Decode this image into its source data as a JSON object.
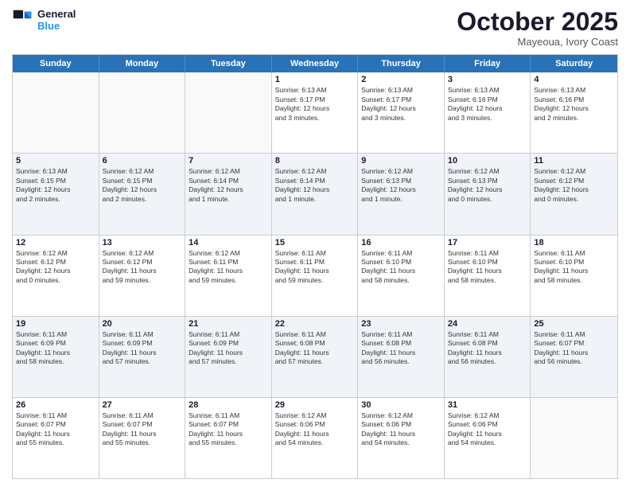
{
  "logo": {
    "line1": "General",
    "line2": "Blue"
  },
  "header": {
    "month": "October 2025",
    "location": "Mayeoua, Ivory Coast"
  },
  "day_headers": [
    "Sunday",
    "Monday",
    "Tuesday",
    "Wednesday",
    "Thursday",
    "Friday",
    "Saturday"
  ],
  "rows": [
    [
      {
        "date": "",
        "info": ""
      },
      {
        "date": "",
        "info": ""
      },
      {
        "date": "",
        "info": ""
      },
      {
        "date": "1",
        "info": "Sunrise: 6:13 AM\nSunset: 6:17 PM\nDaylight: 12 hours\nand 3 minutes."
      },
      {
        "date": "2",
        "info": "Sunrise: 6:13 AM\nSunset: 6:17 PM\nDaylight: 12 hours\nand 3 minutes."
      },
      {
        "date": "3",
        "info": "Sunrise: 6:13 AM\nSunset: 6:16 PM\nDaylight: 12 hours\nand 3 minutes."
      },
      {
        "date": "4",
        "info": "Sunrise: 6:13 AM\nSunset: 6:16 PM\nDaylight: 12 hours\nand 2 minutes."
      }
    ],
    [
      {
        "date": "5",
        "info": "Sunrise: 6:13 AM\nSunset: 6:15 PM\nDaylight: 12 hours\nand 2 minutes."
      },
      {
        "date": "6",
        "info": "Sunrise: 6:12 AM\nSunset: 6:15 PM\nDaylight: 12 hours\nand 2 minutes."
      },
      {
        "date": "7",
        "info": "Sunrise: 6:12 AM\nSunset: 6:14 PM\nDaylight: 12 hours\nand 1 minute."
      },
      {
        "date": "8",
        "info": "Sunrise: 6:12 AM\nSunset: 6:14 PM\nDaylight: 12 hours\nand 1 minute."
      },
      {
        "date": "9",
        "info": "Sunrise: 6:12 AM\nSunset: 6:13 PM\nDaylight: 12 hours\nand 1 minute."
      },
      {
        "date": "10",
        "info": "Sunrise: 6:12 AM\nSunset: 6:13 PM\nDaylight: 12 hours\nand 0 minutes."
      },
      {
        "date": "11",
        "info": "Sunrise: 6:12 AM\nSunset: 6:12 PM\nDaylight: 12 hours\nand 0 minutes."
      }
    ],
    [
      {
        "date": "12",
        "info": "Sunrise: 6:12 AM\nSunset: 6:12 PM\nDaylight: 12 hours\nand 0 minutes."
      },
      {
        "date": "13",
        "info": "Sunrise: 6:12 AM\nSunset: 6:12 PM\nDaylight: 11 hours\nand 59 minutes."
      },
      {
        "date": "14",
        "info": "Sunrise: 6:12 AM\nSunset: 6:11 PM\nDaylight: 11 hours\nand 59 minutes."
      },
      {
        "date": "15",
        "info": "Sunrise: 6:11 AM\nSunset: 6:11 PM\nDaylight: 11 hours\nand 59 minutes."
      },
      {
        "date": "16",
        "info": "Sunrise: 6:11 AM\nSunset: 6:10 PM\nDaylight: 11 hours\nand 58 minutes."
      },
      {
        "date": "17",
        "info": "Sunrise: 6:11 AM\nSunset: 6:10 PM\nDaylight: 11 hours\nand 58 minutes."
      },
      {
        "date": "18",
        "info": "Sunrise: 6:11 AM\nSunset: 6:10 PM\nDaylight: 11 hours\nand 58 minutes."
      }
    ],
    [
      {
        "date": "19",
        "info": "Sunrise: 6:11 AM\nSunset: 6:09 PM\nDaylight: 11 hours\nand 58 minutes."
      },
      {
        "date": "20",
        "info": "Sunrise: 6:11 AM\nSunset: 6:09 PM\nDaylight: 11 hours\nand 57 minutes."
      },
      {
        "date": "21",
        "info": "Sunrise: 6:11 AM\nSunset: 6:09 PM\nDaylight: 11 hours\nand 57 minutes."
      },
      {
        "date": "22",
        "info": "Sunrise: 6:11 AM\nSunset: 6:08 PM\nDaylight: 11 hours\nand 57 minutes."
      },
      {
        "date": "23",
        "info": "Sunrise: 6:11 AM\nSunset: 6:08 PM\nDaylight: 11 hours\nand 56 minutes."
      },
      {
        "date": "24",
        "info": "Sunrise: 6:11 AM\nSunset: 6:08 PM\nDaylight: 11 hours\nand 56 minutes."
      },
      {
        "date": "25",
        "info": "Sunrise: 6:11 AM\nSunset: 6:07 PM\nDaylight: 11 hours\nand 56 minutes."
      }
    ],
    [
      {
        "date": "26",
        "info": "Sunrise: 6:11 AM\nSunset: 6:07 PM\nDaylight: 11 hours\nand 55 minutes."
      },
      {
        "date": "27",
        "info": "Sunrise: 6:11 AM\nSunset: 6:07 PM\nDaylight: 11 hours\nand 55 minutes."
      },
      {
        "date": "28",
        "info": "Sunrise: 6:11 AM\nSunset: 6:07 PM\nDaylight: 11 hours\nand 55 minutes."
      },
      {
        "date": "29",
        "info": "Sunrise: 6:12 AM\nSunset: 6:06 PM\nDaylight: 11 hours\nand 54 minutes."
      },
      {
        "date": "30",
        "info": "Sunrise: 6:12 AM\nSunset: 6:06 PM\nDaylight: 11 hours\nand 54 minutes."
      },
      {
        "date": "31",
        "info": "Sunrise: 6:12 AM\nSunset: 6:06 PM\nDaylight: 11 hours\nand 54 minutes."
      },
      {
        "date": "",
        "info": ""
      }
    ]
  ]
}
